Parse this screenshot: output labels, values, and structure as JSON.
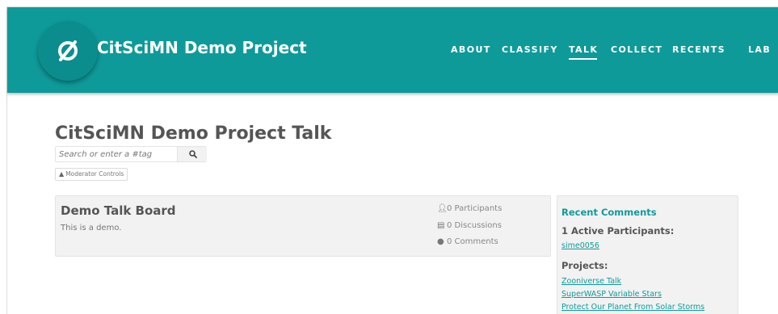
{
  "header": {
    "project_title": "CitSciMN Demo Project",
    "logo_icon": "null-set-icon",
    "nav": [
      {
        "label": "ABOUT",
        "active": false
      },
      {
        "label": "CLASSIFY",
        "active": false
      },
      {
        "label": "TALK",
        "active": true
      },
      {
        "label": "COLLECT",
        "active": false
      },
      {
        "label": "RECENTS",
        "active": false
      },
      {
        "label": "LAB",
        "active": false
      }
    ]
  },
  "talk": {
    "title": "CitSciMN Demo Project Talk",
    "search_placeholder": "Search or enter a #tag",
    "search_icon": "search-icon",
    "moderator_controls_label": "Moderator Controls"
  },
  "board": {
    "title": "Demo Talk Board",
    "description": "This is a demo.",
    "participants": "0 Participants",
    "discussions": "0 Discussions",
    "comments": "0 Comments"
  },
  "sidebar": {
    "recent_comments": "Recent Comments",
    "active_participants_label": "1 Active Participants:",
    "participants": [
      "sime0056"
    ],
    "projects_label": "Projects:",
    "projects": [
      "Zooniverse Talk",
      "SuperWASP Variable Stars",
      "Protect Our Planet From Solar Storms"
    ]
  },
  "colors": {
    "brand": "#0f9a9a",
    "panel": "#f2f2f2"
  }
}
